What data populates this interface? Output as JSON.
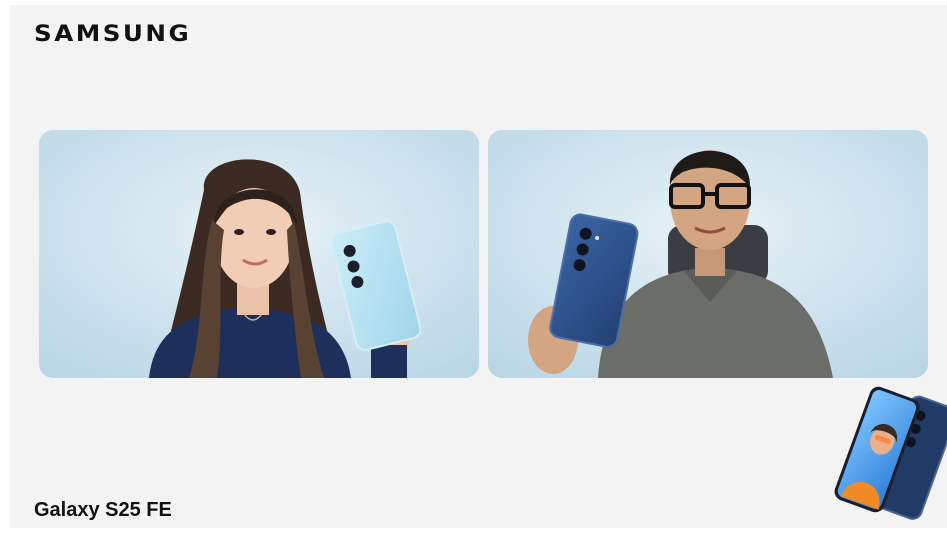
{
  "header": {
    "brand": "SAMSUNG"
  },
  "panels": [
    {
      "participant": "left-presenter",
      "phone_color": "#aee0f1"
    },
    {
      "participant": "right-presenter",
      "phone_color": "#2c4f86"
    }
  ],
  "footer": {
    "product_name": "Galaxy S25 FE"
  },
  "colors": {
    "background": "#f3f3f4",
    "panel_backdrop": "#cfe3ee",
    "text": "#121212",
    "icy_blue": "#aee0f1",
    "navy": "#2c4f86"
  }
}
